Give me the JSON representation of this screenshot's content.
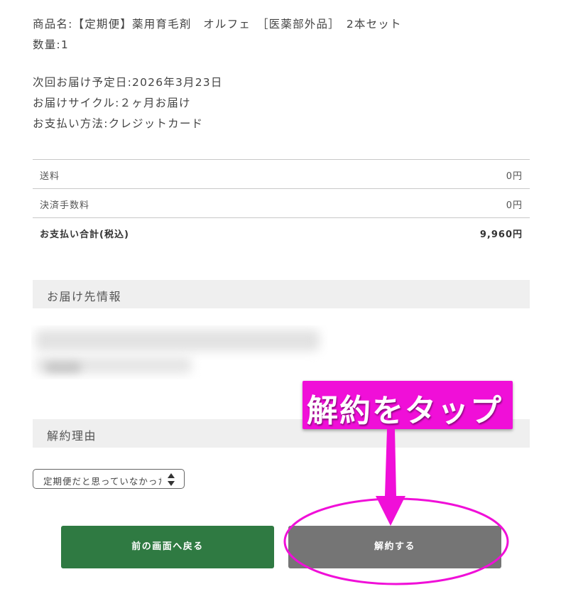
{
  "order": {
    "product_line": "商品名:【定期便】薬用育毛剤　オルフェ　［医薬部外品］　2本セット",
    "quantity_line": "数量:1",
    "next_delivery_line": "次回お届け予定日:2026年3月23日",
    "cycle_line": "お届けサイクル:２ヶ月お届け",
    "payment_line": "お支払い方法:クレジットカード"
  },
  "fees": [
    {
      "label": "送料",
      "value": "0円"
    },
    {
      "label": "決済手数料",
      "value": "0円"
    }
  ],
  "total": {
    "label": "お支払い合計(税込)",
    "value": "9,960円"
  },
  "delivery_section": {
    "title": "お届け先情報"
  },
  "reason_section": {
    "title": "解約理由",
    "selected": "定期便だと思っていなかった"
  },
  "buttons": {
    "back": "前の画面へ戻る",
    "cancel": "解約する"
  },
  "annotation": {
    "text": "解約をタップ",
    "color": "#f00fd8"
  },
  "colors": {
    "back_button": "#2f7a42",
    "cancel_button": "#757575",
    "section_bar": "#efefef"
  },
  "icons": {
    "select_arrows": "updown-arrows-icon",
    "annotation_arrow": "down-arrow-icon"
  }
}
